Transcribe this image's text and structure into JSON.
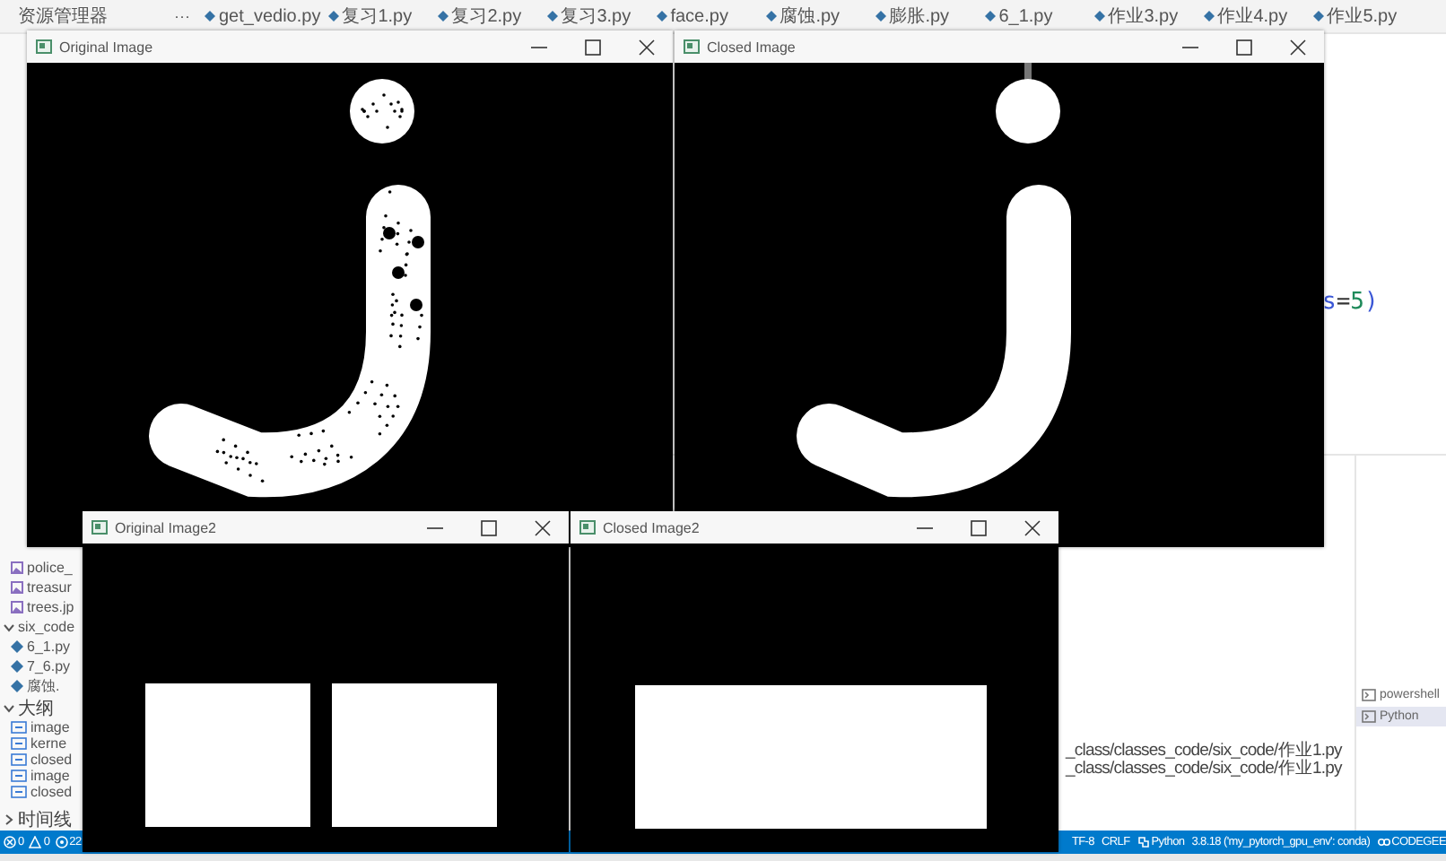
{
  "explorer": {
    "title": "资源管理器",
    "more": "···"
  },
  "tabs": [
    {
      "label": "get_vedio.py"
    },
    {
      "label": "复习1.py"
    },
    {
      "label": "复习2.py"
    },
    {
      "label": "复习3.py"
    },
    {
      "label": "face.py"
    },
    {
      "label": "腐蚀.py"
    },
    {
      "label": "膨胀.py"
    },
    {
      "label": "6_1.py"
    },
    {
      "label": "作业3.py"
    },
    {
      "label": "作业4.py"
    },
    {
      "label": "作业5.py"
    }
  ],
  "sidebar": {
    "items": [
      {
        "kind": "image",
        "label": "police_"
      },
      {
        "kind": "image",
        "label": "treasur"
      },
      {
        "kind": "image",
        "label": "trees.jp"
      },
      {
        "kind": "folder",
        "label": "six_code",
        "expanded": true
      },
      {
        "kind": "python",
        "label": "6_1.py"
      },
      {
        "kind": "python",
        "label": "7_6.py"
      },
      {
        "kind": "python",
        "label": "腐蚀."
      }
    ],
    "outline": {
      "title": "大纲",
      "expanded": true,
      "items": [
        "image",
        "kerne",
        "closed",
        "image",
        "closed"
      ]
    },
    "timeline": {
      "title": "时间线",
      "expanded": false
    }
  },
  "editor": {
    "code": [
      {
        "text": "s",
        "kind": "name"
      },
      {
        "text": "=",
        "kind": "op"
      },
      {
        "text": "5",
        "kind": "number"
      },
      {
        "text": ")",
        "kind": "paren"
      }
    ]
  },
  "terminal": {
    "lines": [
      "_class/classes_code/six_code/作业1.py",
      "_class/classes_code/six_code/作业1.py"
    ],
    "sessions": [
      {
        "label": "powershell",
        "selected": false
      },
      {
        "label": "Python",
        "selected": true
      }
    ]
  },
  "status_bar": {
    "left": [
      {
        "kind": "error",
        "text": "0"
      },
      {
        "kind": "warning",
        "text": "0"
      },
      {
        "kind": "ports",
        "text": "22"
      }
    ],
    "right": [
      {
        "kind": "text",
        "text": "TF-8"
      },
      {
        "kind": "text",
        "text": "CRLF"
      },
      {
        "kind": "language",
        "text": "Python"
      },
      {
        "kind": "text",
        "text": "3.8.18 ('my_pytorch_gpu_env': conda)"
      },
      {
        "kind": "codegeex",
        "text": "CODEGEE"
      }
    ]
  },
  "windows": [
    {
      "title": "Original Image",
      "kind": "j_dotted"
    },
    {
      "title": "Closed Image",
      "kind": "j_closed"
    },
    {
      "title": "Original Image2",
      "kind": "two_rects"
    },
    {
      "title": "Closed Image2",
      "kind": "one_rect"
    }
  ]
}
